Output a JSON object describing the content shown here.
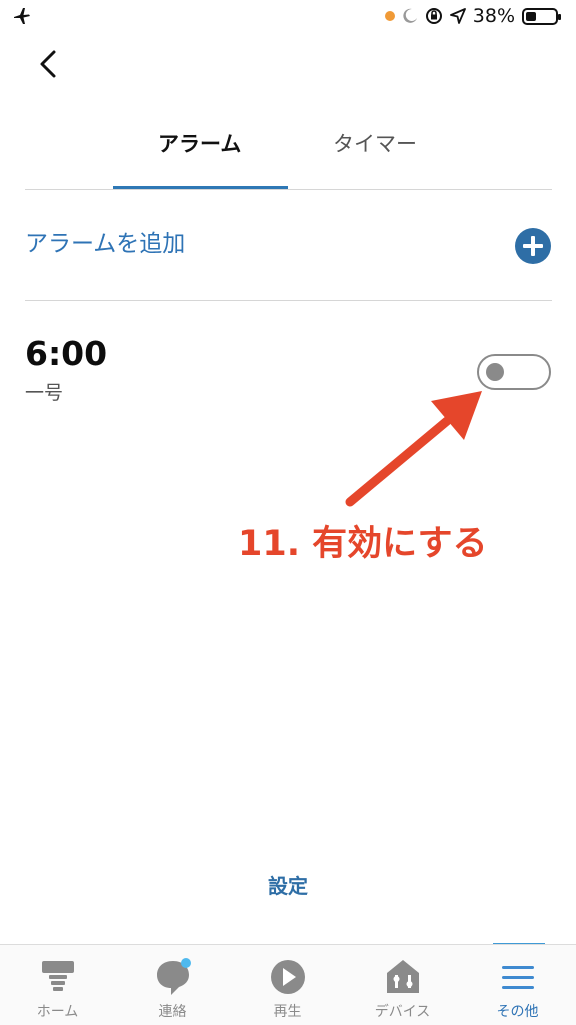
{
  "status_bar": {
    "battery": "38%"
  },
  "tabs": [
    {
      "label": "アラーム",
      "active": true
    },
    {
      "label": "タイマー",
      "active": false
    }
  ],
  "add_alarm": {
    "label": "アラームを追加"
  },
  "alarms": [
    {
      "time": "6:00",
      "label": "一号",
      "enabled": false
    }
  ],
  "annotation": {
    "text": "11. 有効にする",
    "color": "#e5462b"
  },
  "settings": {
    "label": "設定"
  },
  "bottom_nav": [
    {
      "label": "ホーム",
      "icon": "home-icon"
    },
    {
      "label": "連絡",
      "icon": "chat-icon"
    },
    {
      "label": "再生",
      "icon": "play-icon"
    },
    {
      "label": "デバイス",
      "icon": "devices-icon"
    },
    {
      "label": "その他",
      "icon": "menu-icon",
      "active": true
    }
  ],
  "colors": {
    "accent": "#2e73b5",
    "annotation": "#e5462b"
  }
}
